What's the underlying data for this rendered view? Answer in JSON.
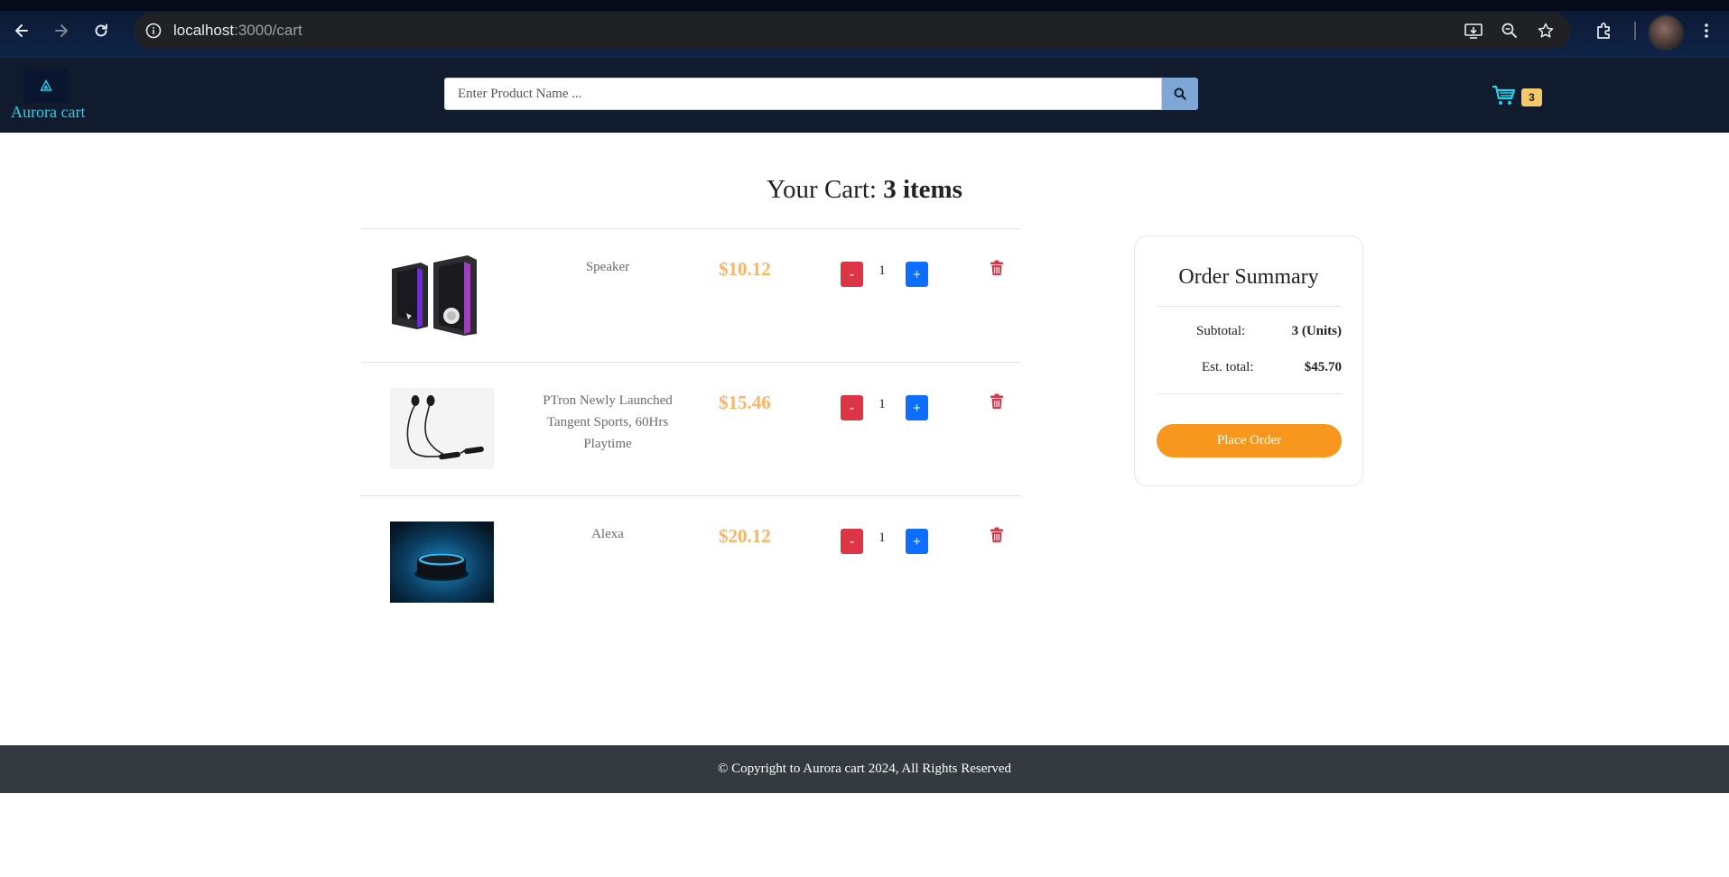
{
  "browser": {
    "url_host": "localhost",
    "url_path": ":3000/cart"
  },
  "header": {
    "brand": "Aurora cart",
    "search_placeholder": "Enter Product Name ...",
    "cart_count": "3"
  },
  "cart": {
    "title_prefix": "Your Cart: ",
    "title_count": "3 items",
    "items": [
      {
        "name": "Speaker",
        "price": "$10.12",
        "qty": "1",
        "minus": "-",
        "plus": "+"
      },
      {
        "name": "PTron Newly Launched Tangent Sports, 60Hrs Playtime",
        "price": "$15.46",
        "qty": "1",
        "minus": "-",
        "plus": "+"
      },
      {
        "name": "Alexa",
        "price": "$20.12",
        "qty": "1",
        "minus": "-",
        "plus": "+"
      }
    ]
  },
  "summary": {
    "title": "Order Summary",
    "subtotal_label": "Subtotal:",
    "subtotal_value": "3 (Units)",
    "total_label": "Est. total:",
    "total_value": "$45.70",
    "place_order": "Place Order"
  },
  "footer": {
    "text": "© Copyright to Aurora cart 2024, All Rights Reserved"
  },
  "colors": {
    "header_bg": "#111b2e",
    "brand": "#22d3ee",
    "price": "#fbb462",
    "minus": "#dc3545",
    "plus": "#0d6efd",
    "trash": "#dc3545",
    "place_order": "#f7971e",
    "footer_bg": "#343a40"
  },
  "icons": [
    "back-icon",
    "forward-icon",
    "reload-icon",
    "site-info-icon",
    "install-icon",
    "zoom-icon",
    "star-icon",
    "extensions-icon",
    "menu-icon",
    "search-icon",
    "cart-icon",
    "trash-icon",
    "logo-icon"
  ]
}
